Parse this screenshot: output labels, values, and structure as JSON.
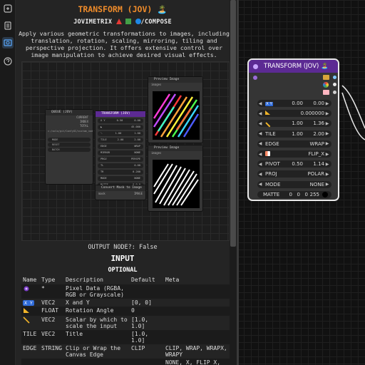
{
  "rail": {
    "icons": [
      "node-library-icon",
      "queue-icon",
      "image-gallery-icon",
      "help-icon"
    ]
  },
  "doc": {
    "title": "TRANSFORM (JOV) 🏝️",
    "subtitle_brand": "JOVIMETRIX",
    "subtitle_path": "/COMPOSE",
    "description": "Apply various geometric transformations to images, including translation, rotation, scaling, mirroring, tiling and perspective projection. It offers extensive control over image manipulation to achieve desired visual effects.",
    "output_node": "OUTPUT NODE?: False",
    "input_heading": "INPUT",
    "optional_heading": "OPTIONAL",
    "table": {
      "headers": [
        "Name",
        "Type",
        "Description",
        "Default",
        "Meta"
      ],
      "rows": [
        {
          "name_icon": "pixel-icon",
          "type": "*",
          "desc": "Pixel Data (RGBA, RGB or Grayscale)",
          "default": "",
          "meta": ""
        },
        {
          "name_badge": "X Y",
          "type": "VEC2",
          "desc": "X and Y",
          "default": "[0, 0]",
          "meta": ""
        },
        {
          "name_icon": "angle-icon",
          "type": "FLOAT",
          "desc": "Rotation Angle",
          "default": "0",
          "meta": ""
        },
        {
          "name_icon": "size-icon",
          "type": "VEC2",
          "desc": "Scalar by which to scale the input",
          "default": "[1.0, 1.0]",
          "meta": ""
        },
        {
          "name": "TILE",
          "type": "VEC2",
          "desc": "Title",
          "default": "[1.0, 1.0]",
          "meta": ""
        },
        {
          "name": "EDGE",
          "type": "STRING",
          "desc": "Clip or Wrap the Canvas Edge",
          "default": "CLIP",
          "meta": "CLIP, WRAP, WRAPX, WRAPY"
        },
        {
          "name": "",
          "type": "",
          "desc": "",
          "default": "",
          "meta": "NONE, X, FLIP_X,"
        }
      ]
    }
  },
  "preview": {
    "queue_node": "QUEUE (JOV)",
    "transform_node": "TRANSFORM (JOV)",
    "preview_a": "Preview Image",
    "preview_b": "Preview Image",
    "mask_node": "Convert Mask to Image",
    "images_label": "images",
    "queue_rows": [
      {
        "label": "CURRENT"
      },
      {
        "label": "INDEX"
      },
      {
        "label": "TOTAL"
      }
    ],
    "queue_file": "c:/solo/git/ComfyUI/custom_nodes/Jovimetrix/res/aaa_s.png",
    "queue_fields": [
      "MODE",
      "RESET",
      "BATCH"
    ],
    "transform_rows": [
      {
        "label": "X Y",
        "a": "0.50",
        "b": "0.00"
      },
      {
        "label": "◣",
        "a": "",
        "b": "45.000"
      },
      {
        "label": "⟍",
        "a": "1.00",
        "b": "1.00"
      },
      {
        "label": "TILE",
        "a": "2.00",
        "b": "2.00"
      },
      {
        "label": "EDGE",
        "a": "",
        "b": "WRAP"
      },
      {
        "label": "MIRROR",
        "a": "",
        "b": "NONE"
      },
      {
        "label": "PROJ",
        "a": "",
        "b": "PERSPE"
      },
      {
        "label": "TL",
        "a": "",
        "b": "0.00"
      },
      {
        "label": "TR",
        "a": "",
        "b": "0.200"
      },
      {
        "label": "MODE",
        "a": "",
        "b": "NONE"
      },
      {
        "label": "MATTE",
        "a": "",
        "b": "0 0 0"
      }
    ],
    "mask_rows": [
      {
        "label": "mask"
      },
      {
        "label": "IMAGE"
      }
    ]
  },
  "node": {
    "title": "TRANSFORM (JOV) 🏝️",
    "rows": [
      {
        "kind": "xy",
        "badge": "X Y",
        "a": "0.00",
        "b": "0.00"
      },
      {
        "kind": "single",
        "icon": "angle-icon",
        "val": "0.000000"
      },
      {
        "kind": "pair",
        "icon": "size-icon",
        "a": "1.00",
        "b": "1.36"
      },
      {
        "kind": "pair",
        "label": "TILE",
        "a": "1.00",
        "b": "2.00"
      },
      {
        "kind": "combo",
        "label": "EDGE",
        "val": "WRAP"
      },
      {
        "kind": "combo",
        "icon": "mirror-icon",
        "val": "FLIP_X"
      },
      {
        "kind": "pair",
        "label": "PIVOT",
        "a": "0.50",
        "b": "1.14"
      },
      {
        "kind": "combo",
        "label": "PROJ",
        "val": "POLAR"
      },
      {
        "kind": "combo",
        "label": "MODE",
        "val": "NONE"
      },
      {
        "kind": "matte",
        "label": "MATTE",
        "vals": [
          "0",
          "0",
          "0",
          "255"
        ]
      }
    ],
    "colors": {
      "header": "#5c2a93",
      "output_dots": [
        "#7ec8ff",
        "#e8e8e8",
        "#d0d0d0"
      ]
    }
  }
}
